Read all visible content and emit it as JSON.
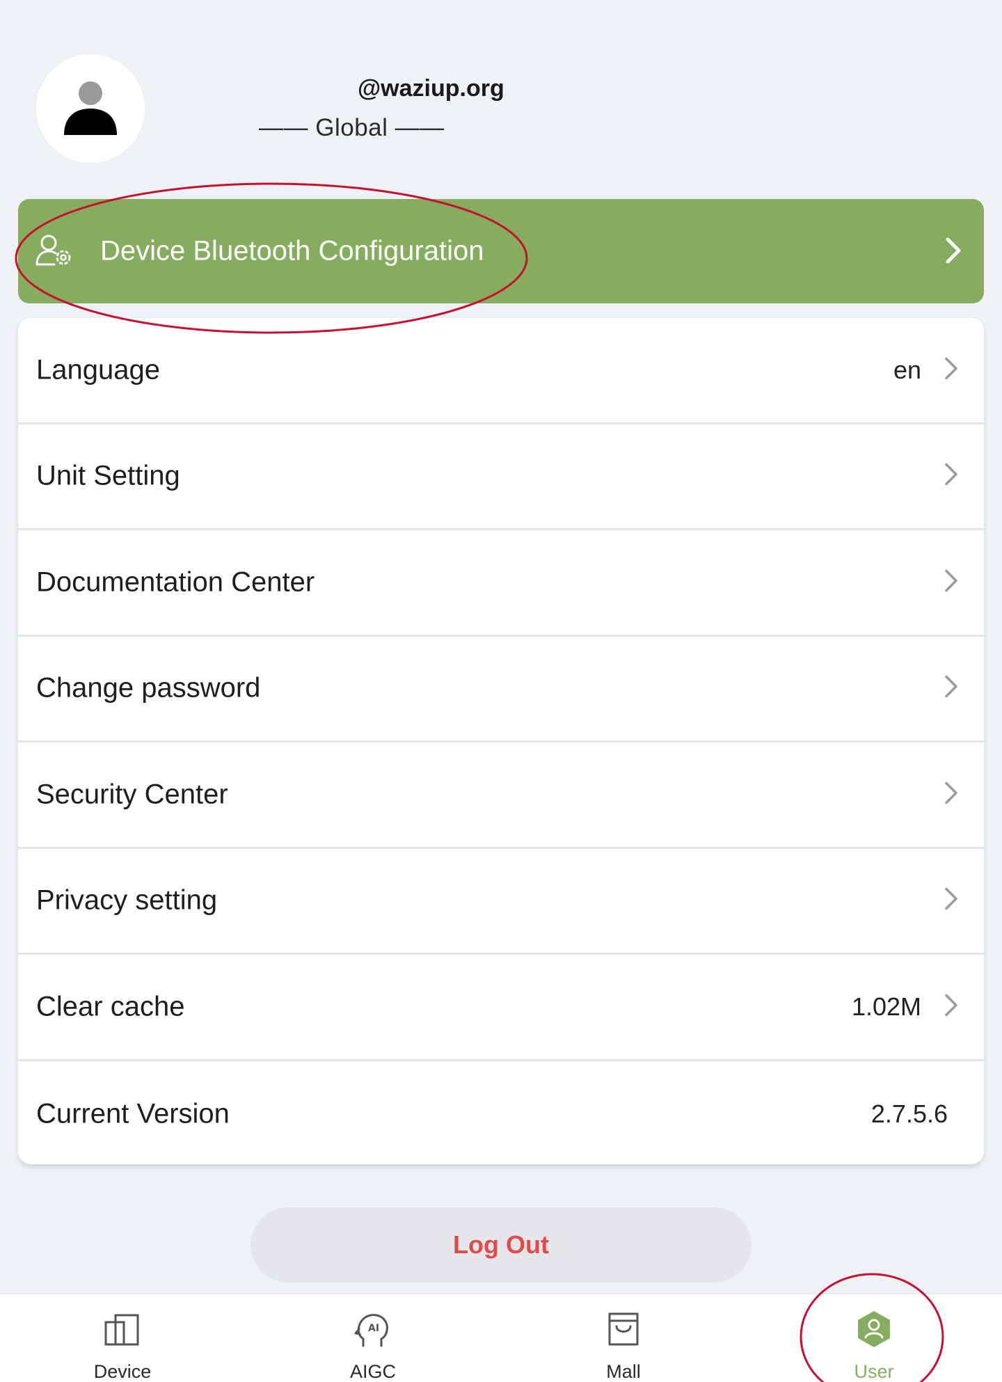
{
  "profile": {
    "username": "@waziup.org",
    "region": "—— Global ——"
  },
  "bluetooth_banner": {
    "label": "Device Bluetooth Configuration",
    "icon": "user-gear-icon"
  },
  "settings": [
    {
      "label": "Language",
      "value": "en",
      "chevron": true
    },
    {
      "label": "Unit Setting",
      "value": "",
      "chevron": true
    },
    {
      "label": "Documentation Center",
      "value": "",
      "chevron": true
    },
    {
      "label": "Change password",
      "value": "",
      "chevron": true
    },
    {
      "label": "Security Center",
      "value": "",
      "chevron": true
    },
    {
      "label": "Privacy setting",
      "value": "",
      "chevron": true
    },
    {
      "label": "Clear cache",
      "value": "1.02M",
      "chevron": true
    },
    {
      "label": "Current Version",
      "value": "2.7.5.6",
      "chevron": false
    }
  ],
  "logout": {
    "label": "Log Out"
  },
  "bottom_nav": [
    {
      "label": "Device",
      "icon": "device-icon",
      "active": false
    },
    {
      "label": "AIGC",
      "icon": "ai-head-icon",
      "active": false
    },
    {
      "label": "Mall",
      "icon": "shopping-bag-icon",
      "active": false
    },
    {
      "label": "User",
      "icon": "user-icon",
      "active": true
    }
  ],
  "colors": {
    "accent_green": "#86ad5f",
    "logout_red": "#e04b4b",
    "annotation_red": "#c8102e"
  }
}
